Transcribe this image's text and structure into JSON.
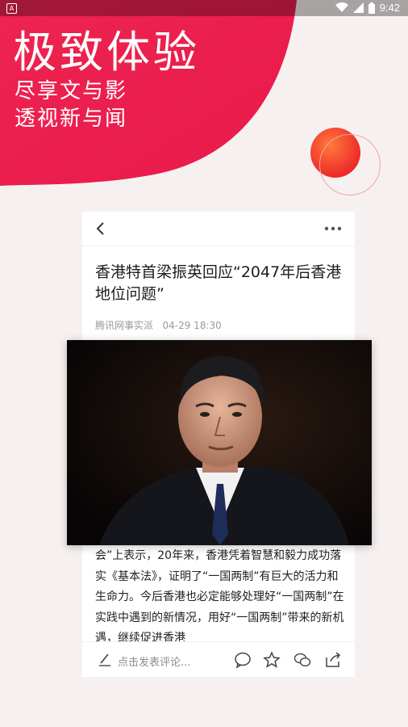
{
  "status_bar": {
    "time": "9:42",
    "app_icon_letter": "A"
  },
  "hero": {
    "title": "极致体验",
    "subtitle_line1": "尽享文与影",
    "subtitle_line2": "透视新与闻",
    "colors": {
      "gradient_start": "#e8264e",
      "gradient_end": "#ff4f6d"
    }
  },
  "article": {
    "headline": "香港特首梁振英回应“2047年后香港地位问题”",
    "source": "腾讯网事实派",
    "datetime": "04-29 18:30",
    "body": "会”上表示，20年来，香港凭着智慧和毅力成功落实《基本法》，证明了“一国两制”有巨大的活力和生命力。今后香港也必定能够处理好“一国两制”在实践中遇到的新情况，用好“一国两制”带来的新机遇，继续促进香港"
  },
  "comment_bar": {
    "placeholder": "点击发表评论..."
  }
}
